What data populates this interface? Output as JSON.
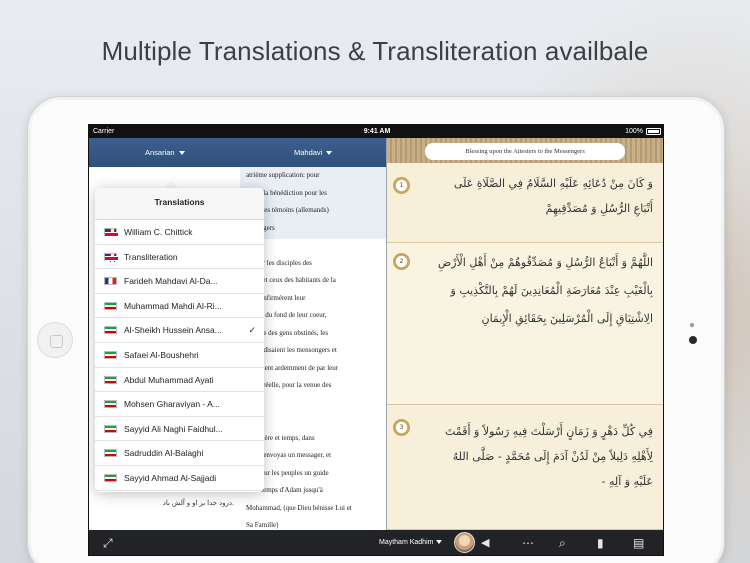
{
  "headline": "Multiple Translations & Transliteration availbale",
  "status_bar": {
    "carrier": "Carrier",
    "time": "9:41 AM",
    "battery": "100%"
  },
  "left_pane": {
    "tabs": [
      {
        "label": "Ansarian"
      },
      {
        "label": "Mahdavi"
      }
    ],
    "french_lines": [
      "atrième supplication: pour",
      "ander la bénédiction pour les",
      "les et les témoins (allemands)",
      "messagers",
      "",
      "). Pour les disciples des",
      "agers et ceux des habitants de la",
      "qui confirmèrent leur",
      "nticité du fond de leur coeur,",
      "ant que des gens obstinés, les",
      "contredisaient les mensongers et",
      "desiraient ardemment de par leur",
      "ère et réelle, pour la venue des",
      "aires.",
      "",
      "haque ère et temps, dans",
      "ls Tu, envoyas un messager, et",
      "nas pour les peuples un guide",
      "is du temps d'Adam jusqu'à",
      "Mohammad, (que Dieu bénisse Lui et",
      "Sa Famille)"
    ],
    "persian_line": "درود خدا بر او و آلش باد."
  },
  "popover": {
    "title": "Translations",
    "items": [
      {
        "flag": "uk",
        "label": "William C. Chittick",
        "selected": false
      },
      {
        "flag": "uk",
        "label": "Transliteration",
        "selected": false
      },
      {
        "flag": "fr",
        "label": "Farideh Mahdavi Al-Da...",
        "selected": false
      },
      {
        "flag": "ir",
        "label": "Muhammad Mahdi Al-Ri...",
        "selected": false
      },
      {
        "flag": "ir",
        "label": "Al-Sheikh Hussein Ansa...",
        "selected": true,
        "check": "✓"
      },
      {
        "flag": "ir",
        "label": "Safaei Al-Boushehri",
        "selected": false
      },
      {
        "flag": "ir",
        "label": "Abdul Muhammad Ayati",
        "selected": false
      },
      {
        "flag": "ir",
        "label": "Mohsen Gharaviyan - A...",
        "selected": false
      },
      {
        "flag": "ir",
        "label": "Sayyid Ali Naghi Faidhul...",
        "selected": false
      },
      {
        "flag": "ir",
        "label": "Sadruddin Al-Balaghi",
        "selected": false
      },
      {
        "flag": "ir",
        "label": "Sayyid Ahmad Al-Sajjadi",
        "selected": false
      }
    ]
  },
  "right_pane": {
    "title": "Blessing upon the Attesters to the Messengers",
    "verses": [
      {
        "num": "1",
        "lines": [
          "وَ كَانَ مِنْ دُعَائِهِ عَلَيْهِ السَّلَامُ فِي الصَّلَاةِ عَلَى",
          "أَتْبَاعِ الرُّسُلِ وَ مُصَدِّقِيهِمْ"
        ]
      },
      {
        "num": "2",
        "lines": [
          "اللَّهُمَّ وَ أَتْبَاعُ الرُّسُلِ وَ مُصَدِّقُوهُمْ مِنْ أَهْلِ الْأَرْضِ",
          "بِالْغَيْبِ عِنْدَ مُعَارَضَةِ الْمُعَانِدِينَ لَهُمْ بِالتَّكْذِيبِ وَ",
          "الِاشْتِيَاقِ إِلَى الْمُرْسَلِينَ بِحَقَائِقِ الْإِيمَانِ"
        ]
      },
      {
        "num": "3",
        "lines": [
          "فِي كُلِّ دَهْرٍ وَ زَمَانٍ أَرْسَلْتَ فِيهِ رَسُولاً وَ أَقَمْتَ",
          "لِأَهْلِهِ دَلِيلاً مِنْ لَدُنْ آدَمَ إِلَى مُحَمَّدٍ - صَلَّى اللهُ",
          "عَلَيْهِ وَ آلِهِ -"
        ]
      }
    ]
  },
  "toolbar": {
    "reciter": "Maytham Kadhim",
    "icons": [
      "expand-icon",
      "speaker-icon",
      "more-icon",
      "search-icon",
      "bookmark-icon",
      "book-icon"
    ]
  }
}
